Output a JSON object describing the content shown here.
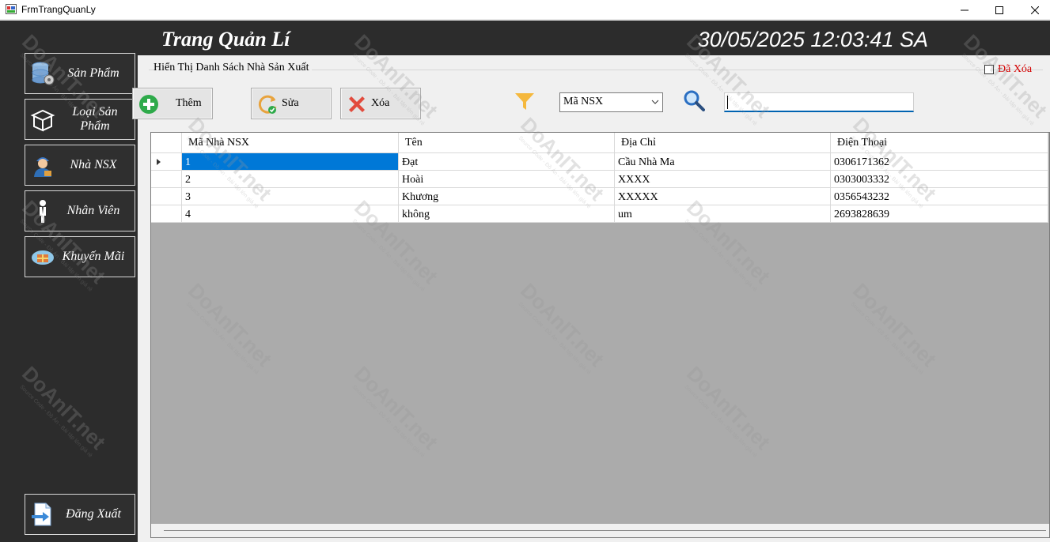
{
  "window": {
    "title": "FrmTrangQuanLy"
  },
  "header": {
    "title": "Trang Quản Lí",
    "clock": "30/05/2025 12:03:41 SA"
  },
  "sidebar": {
    "items": [
      {
        "label": "Sản Phẩm",
        "icon": "database-gear-icon"
      },
      {
        "label_line1": "Loại Sản",
        "label_line2": "Phẩm",
        "icon": "box-icon"
      },
      {
        "label": "Nhà NSX",
        "icon": "worker-icon"
      },
      {
        "label": "Nhân Viên",
        "icon": "person-icon"
      },
      {
        "label": "Khuyến Mãi",
        "icon": "gift-icon"
      }
    ],
    "logout": {
      "label": "Đăng Xuất",
      "icon": "logout-icon"
    }
  },
  "content": {
    "group_caption": "Hiển Thị Danh Sách Nhà Sản Xuất",
    "deleted_checkbox": {
      "label": "Đã Xóa",
      "checked": false
    },
    "toolbar": {
      "add_label": "Thêm",
      "edit_label": "Sửa",
      "delete_label": "Xóa"
    },
    "filter": {
      "selected": "Mã NSX"
    },
    "search": {
      "value": ""
    }
  },
  "grid": {
    "columns": [
      "Mã Nhà NSX",
      "Tên",
      "Địa Chỉ",
      "Điện Thoại"
    ],
    "rows": [
      [
        "1",
        "Đạt",
        "Cầu Nhà Ma",
        "0306171362"
      ],
      [
        "2",
        "Hoài",
        "XXXX",
        "0303003332"
      ],
      [
        "3",
        "Khương",
        "XXXXX",
        "0356543232"
      ],
      [
        "4",
        "không",
        "um",
        "2693828639"
      ]
    ]
  },
  "watermark": {
    "brand": "DoAnIT.net",
    "tagline": "Source Code - Đồ Án - Bài tập lớn giá rẻ"
  },
  "colors": {
    "sidebar_bg": "#2c2c2c",
    "selection": "#0078d7",
    "deleted_label": "#d40000",
    "grid_empty": "#ababab"
  }
}
